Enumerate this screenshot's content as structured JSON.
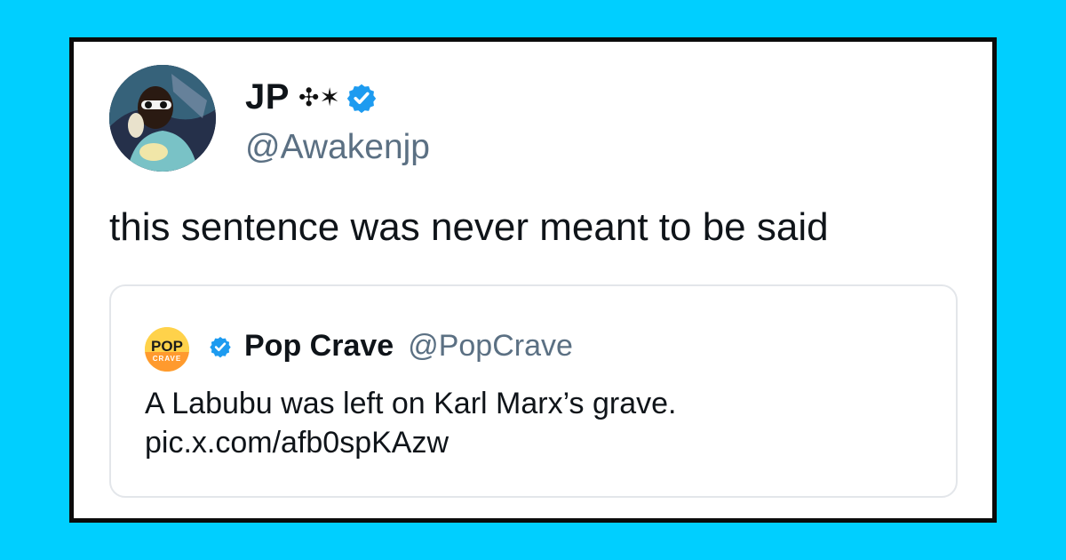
{
  "tweet": {
    "author_name": "JP",
    "author_name_emoji": "✣✶",
    "author_handle": "@Awakenjp",
    "text": "this sentence was never meant to be said",
    "verified": true
  },
  "quoted_tweet": {
    "avatar_text_top": "POP",
    "avatar_text_bottom": "CRAVE",
    "author_name": "Pop Crave",
    "author_handle": "@PopCrave",
    "text_line1": "A Labubu was left on Karl Marx’s grave.",
    "text_line2": "pic.x.com/afb0spKAzw",
    "verified": true
  },
  "colors": {
    "background": "#00cfff",
    "verified_badge": "#1d9bf0",
    "handle_text": "#5b7083",
    "popcrave_yellow": "#ffd24a"
  },
  "icons": {
    "verified": "verified-badge-icon",
    "author_avatar": "profile-photo",
    "quote_avatar": "pop-crave-logo"
  }
}
